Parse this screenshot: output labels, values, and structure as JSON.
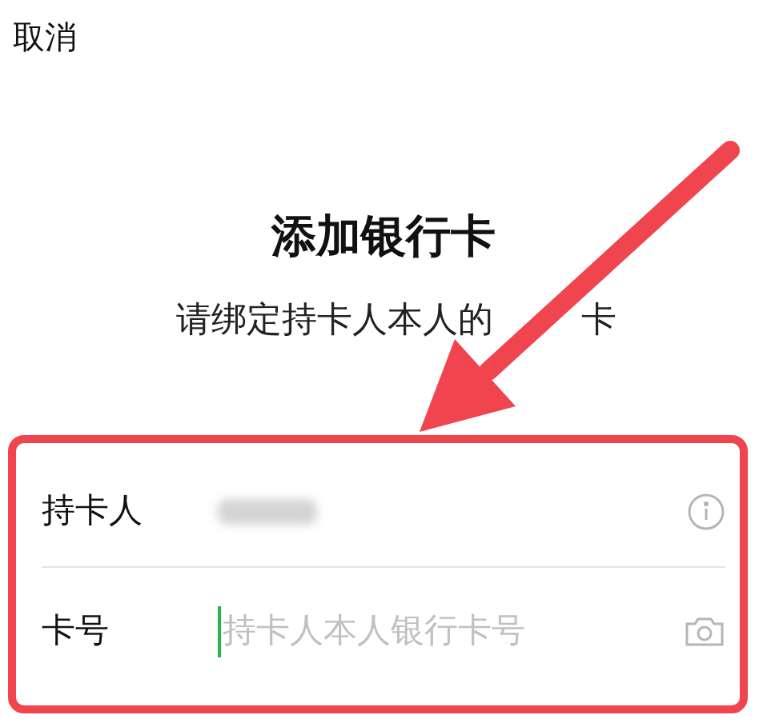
{
  "cancel": "取消",
  "title": "添加银行卡",
  "subtitle": [
    "请绑定持卡人本人的",
    "卡"
  ],
  "fields": [
    {
      "label": "持卡人",
      "kind": "name"
    },
    {
      "label": "卡号",
      "kind": "card",
      "placeholder": "持卡人本人银行卡号"
    }
  ]
}
